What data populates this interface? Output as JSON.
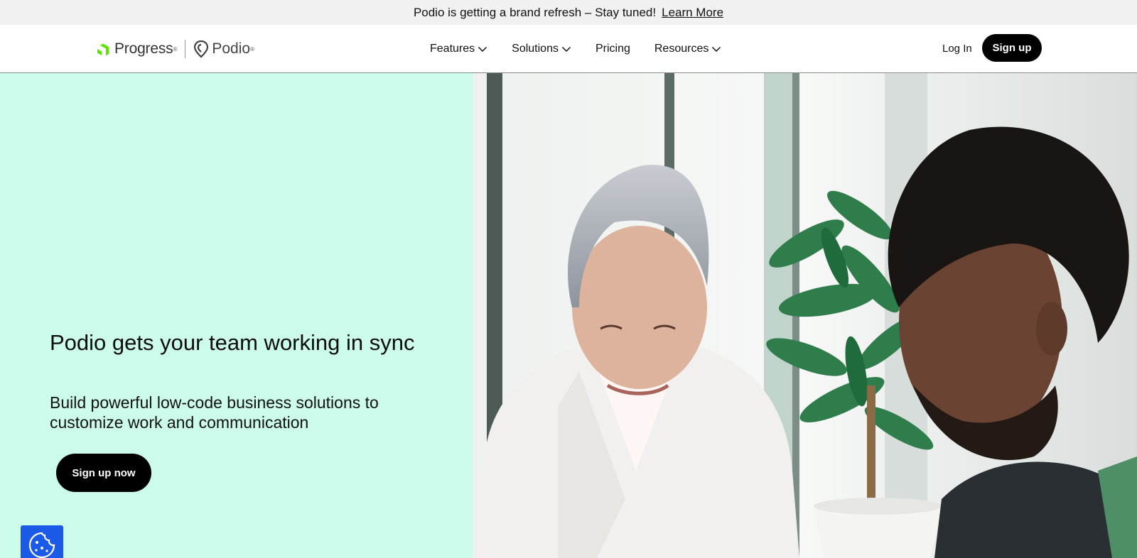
{
  "announcement": {
    "message": "Podio is getting a brand refresh – Stay tuned!",
    "link_label": "Learn More"
  },
  "header": {
    "logo_progress": "Progress",
    "logo_podio": "Podio",
    "nav": [
      {
        "label": "Features",
        "has_dropdown": true
      },
      {
        "label": "Solutions",
        "has_dropdown": true
      },
      {
        "label": "Pricing",
        "has_dropdown": false
      },
      {
        "label": "Resources",
        "has_dropdown": true
      }
    ],
    "login_label": "Log In",
    "signup_label": "Sign up"
  },
  "hero": {
    "title": "Podio gets your team working in sync",
    "subtitle": "Build powerful low-code business solutions to customize work and communication",
    "cta_label": "Sign up now",
    "image_alt": "Two colleagues looking down at work in a bright office with a plant"
  },
  "cookie": {
    "icon": "cookie-icon"
  },
  "colors": {
    "hero_bg": "#ccfbeb",
    "brand_green": "#5ce500",
    "button_black": "#000000",
    "cookie_blue": "#1a5ae6"
  }
}
